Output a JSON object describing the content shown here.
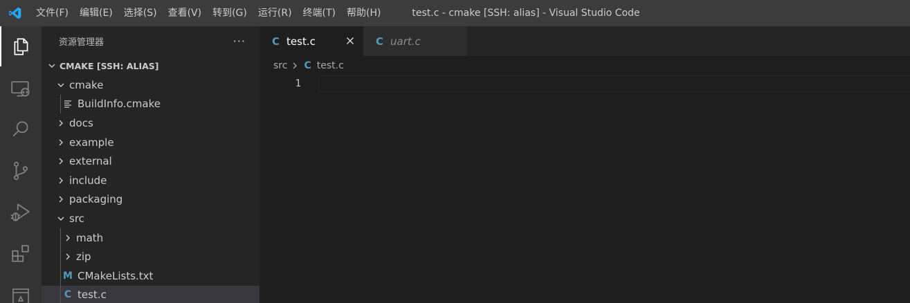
{
  "titlebar": {
    "menu": [
      "文件(F)",
      "编辑(E)",
      "选择(S)",
      "查看(V)",
      "转到(G)",
      "运行(R)",
      "终端(T)",
      "帮助(H)"
    ],
    "window_title": "test.c - cmake [SSH: alias] - Visual Studio Code",
    "logo_icon": "vscode-logo-icon"
  },
  "activitybar": {
    "items": [
      "explorer-icon",
      "remote-explorer-icon",
      "search-icon",
      "source-control-icon",
      "run-debug-icon",
      "extensions-icon",
      "remote-icon"
    ],
    "active": "explorer-icon"
  },
  "sidebar": {
    "title": "资源管理器",
    "more": "···",
    "section_title": "CMAKE [SSH: ALIAS]",
    "tree": [
      {
        "label": "cmake",
        "type": "folder",
        "expanded": true,
        "depth": 0
      },
      {
        "label": "BuildInfo.cmake",
        "type": "file",
        "icon": "lines-icon",
        "depth": 1
      },
      {
        "label": "docs",
        "type": "folder",
        "expanded": false,
        "depth": 0
      },
      {
        "label": "example",
        "type": "folder",
        "expanded": false,
        "depth": 0
      },
      {
        "label": "external",
        "type": "folder",
        "expanded": false,
        "depth": 0
      },
      {
        "label": "include",
        "type": "folder",
        "expanded": false,
        "depth": 0
      },
      {
        "label": "packaging",
        "type": "folder",
        "expanded": false,
        "depth": 0
      },
      {
        "label": "src",
        "type": "folder",
        "expanded": true,
        "depth": 0
      },
      {
        "label": "math",
        "type": "folder",
        "expanded": false,
        "depth": 1
      },
      {
        "label": "zip",
        "type": "folder",
        "expanded": false,
        "depth": 1
      },
      {
        "label": "CMakeLists.txt",
        "type": "file",
        "icon": "M",
        "depth": 1
      },
      {
        "label": "test.c",
        "type": "file",
        "icon": "C",
        "depth": 1,
        "selected": true
      }
    ]
  },
  "editor": {
    "tabs": [
      {
        "label": "test.c",
        "icon": "C",
        "active": true
      },
      {
        "label": "uart.c",
        "icon": "C",
        "active": false
      }
    ],
    "breadcrumb": {
      "folder": "src",
      "file_icon": "C",
      "file": "test.c"
    },
    "lines": [
      "1"
    ]
  },
  "colors": {
    "c_icon": "#519aba",
    "m_icon": "#519aba",
    "titlebar": "#3c3c3c",
    "activitybar": "#333333",
    "sidebar": "#252526",
    "editor": "#1e1e1e"
  }
}
